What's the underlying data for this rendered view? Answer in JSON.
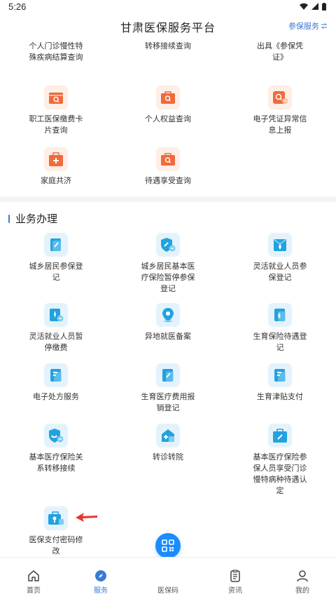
{
  "status_bar": {
    "time": "5:26"
  },
  "header": {
    "title": "甘肃医保服务平台",
    "action_label": "参保服务"
  },
  "query_items": [
    {
      "label": "个人门诊慢性特殊疾病结算查询",
      "icon": "card-icon"
    },
    {
      "label": "转移接续查询",
      "icon": "transfer-icon"
    },
    {
      "label": "出具《参保凭证》",
      "icon": "certificate-icon"
    },
    {
      "label": "职工医保缴费卡片查询",
      "icon": "payment-card-search-icon"
    },
    {
      "label": "个人权益查询",
      "icon": "rights-search-icon"
    },
    {
      "label": "电子凭证异常信息上报",
      "icon": "report-icon"
    },
    {
      "label": "家庭共济",
      "icon": "family-aid-icon"
    },
    {
      "label": "待遇享受查询",
      "icon": "benefit-search-icon"
    }
  ],
  "business_section": {
    "title": "业务办理",
    "items": [
      {
        "label": "城乡居民参保登记",
        "icon": "register-icon"
      },
      {
        "label": "城乡居民基本医疗保险暂停参保登记",
        "icon": "shield-pause-icon"
      },
      {
        "label": "灵活就业人员参保登记",
        "icon": "worker-register-icon"
      },
      {
        "label": "灵活就业人员暂停缴费",
        "icon": "worker-pause-icon"
      },
      {
        "label": "异地就医备案",
        "icon": "location-icon"
      },
      {
        "label": "生育保险待遇登记",
        "icon": "maternity-icon"
      },
      {
        "label": "电子处方服务",
        "icon": "prescription-icon"
      },
      {
        "label": "生育医疗费用报销登记",
        "icon": "reimburse-icon"
      },
      {
        "label": "生育津贴支付",
        "icon": "allowance-icon"
      },
      {
        "label": "基本医疗保险关系转移接续",
        "icon": "shield-transfer-icon"
      },
      {
        "label": "转诊转院",
        "icon": "hospital-icon"
      },
      {
        "label": "基本医疗保险参保人员享受门诊慢特病种待遇认定",
        "icon": "chronic-icon"
      },
      {
        "label": "医保支付密码修改",
        "icon": "password-icon"
      }
    ]
  },
  "tabbar": {
    "items": [
      {
        "label": "首页",
        "icon": "home-icon"
      },
      {
        "label": "服务",
        "icon": "compass-icon"
      },
      {
        "label": "医保码",
        "icon": "qr-icon"
      },
      {
        "label": "资讯",
        "icon": "news-icon"
      },
      {
        "label": "我的",
        "icon": "user-icon"
      }
    ]
  },
  "colors": {
    "accent": "#3a7bd5",
    "fab": "#1a8cff",
    "orange_icon": "#f06a3c",
    "blue_icon": "#22a2e0",
    "arrow": "#e8342f"
  }
}
